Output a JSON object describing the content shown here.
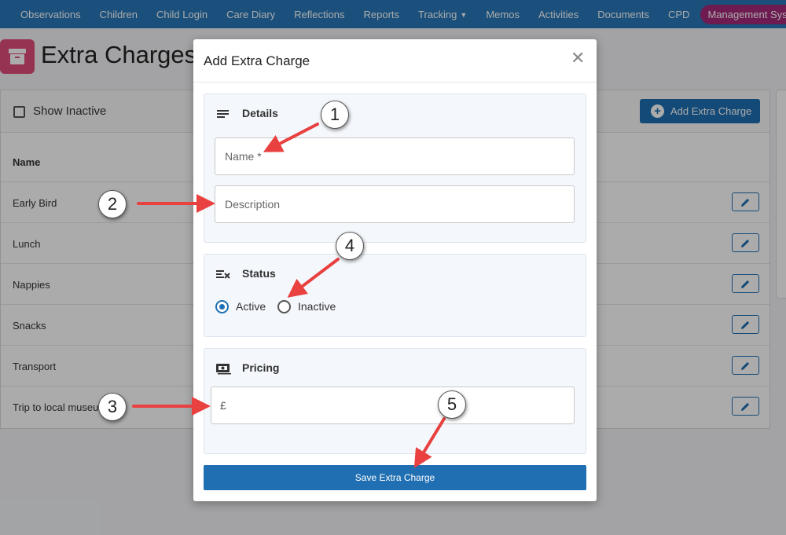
{
  "nav": {
    "items": [
      "Observations",
      "Children",
      "Child Login",
      "Care Diary",
      "Reflections",
      "Reports",
      "Tracking",
      "Memos",
      "Activities",
      "Documents",
      "CPD"
    ],
    "pill": "Management System"
  },
  "page": {
    "title": "Extra Charges",
    "show_inactive": "Show Inactive",
    "add_button": "Add Extra Charge",
    "column_name": "Name",
    "rows": [
      "Early Bird",
      "Lunch",
      "Nappies",
      "Snacks",
      "Transport",
      "Trip to local museum"
    ]
  },
  "modal": {
    "title": "Add Extra Charge",
    "details": {
      "title": "Details",
      "name_placeholder": "Name *",
      "description_placeholder": "Description"
    },
    "status": {
      "title": "Status",
      "active": "Active",
      "inactive": "Inactive",
      "selected": "Active"
    },
    "pricing": {
      "title": "Pricing",
      "currency": "£",
      "value": ""
    },
    "save": "Save Extra Charge"
  },
  "annotations": [
    "1",
    "2",
    "3",
    "4",
    "5"
  ],
  "colors": {
    "nav": "#2778b8",
    "pill": "#a4297a",
    "primary": "#1f6fb2",
    "arrow": "#e94040"
  }
}
